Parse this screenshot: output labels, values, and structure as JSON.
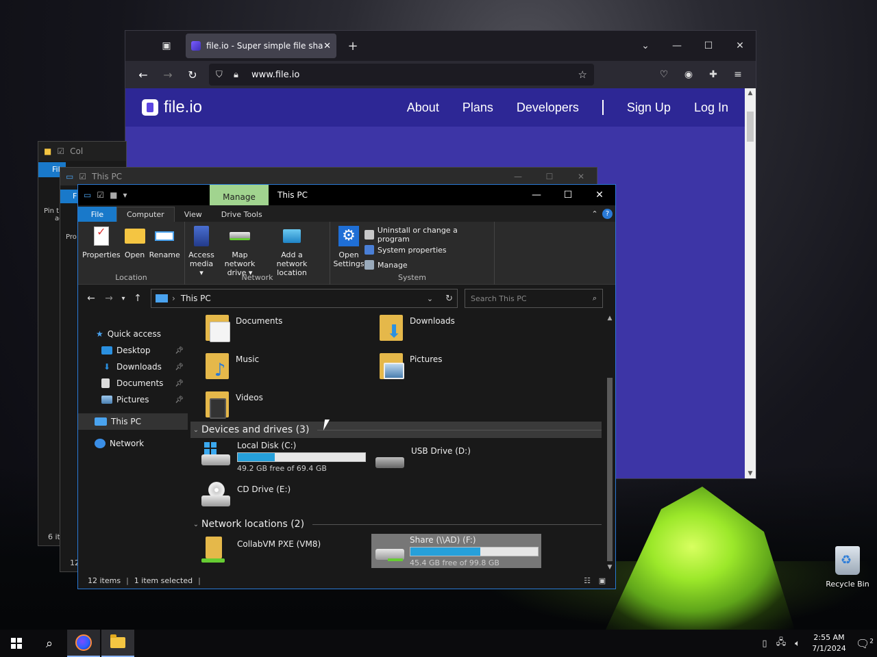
{
  "desktop": {
    "recycle_bin_label": "Recycle Bin"
  },
  "taskbar": {
    "time": "2:55 AM",
    "date": "7/1/2024",
    "notification_count": "2"
  },
  "firefox": {
    "tab_title": "file.io - Super simple file sharing",
    "url": "www.file.io",
    "site": {
      "logo_text": "file.io",
      "nav": [
        "About",
        "Plans",
        "Developers",
        "Sign Up",
        "Log In"
      ]
    }
  },
  "back_window_1": {
    "title": "Col",
    "file_tab": "Fil",
    "pin_text": "Pin t",
    "pin_text2": "ac",
    "status": "6 it"
  },
  "back_window_2": {
    "title": "This PC",
    "status": "12",
    "file_tab": "F",
    "pro_text": "Pro"
  },
  "explorer": {
    "title": "This PC",
    "manage_tab": "Manage",
    "tabs": [
      "File",
      "Computer",
      "View",
      "Drive Tools"
    ],
    "ribbon": {
      "location": {
        "label": "Location",
        "buttons": [
          "Properties",
          "Open",
          "Rename"
        ]
      },
      "network": {
        "label": "Network",
        "buttons": [
          "Access media ▾",
          "Map network drive ▾",
          "Add a network location"
        ]
      },
      "system": {
        "label": "System",
        "open_settings": "Open Settings",
        "items": [
          "Uninstall or change a program",
          "System properties",
          "Manage"
        ]
      }
    },
    "address": "This PC",
    "search_placeholder": "Search This PC",
    "nav_pane": {
      "quick_access": "Quick access",
      "items": [
        "Desktop",
        "Downloads",
        "Documents",
        "Pictures"
      ],
      "this_pc": "This PC",
      "network": "Network"
    },
    "folders": [
      "Documents",
      "Downloads",
      "Music",
      "Pictures",
      "Videos"
    ],
    "devices_header": "Devices and drives (3)",
    "drives": [
      {
        "name": "Local Disk (C:)",
        "free": "49.2 GB free of 69.4 GB",
        "used_fraction": 0.29
      },
      {
        "name": "USB Drive (D:)"
      },
      {
        "name": "CD Drive (E:)"
      }
    ],
    "network_header": "Network locations (2)",
    "network_locations": [
      {
        "name": "CollabVM PXE (VM8)"
      },
      {
        "name": "Share (\\\\AD) (F:)",
        "free": "45.4 GB free of 99.8 GB",
        "used_fraction": 0.55
      }
    ],
    "status": {
      "items": "12 items",
      "selected": "1 item selected"
    }
  },
  "colors": {
    "site_header": "#2d2795",
    "site_body": "#3d35a6",
    "manage_tab": "#a1d48f",
    "file_tab": "#1979ca",
    "drive_bar": "#26a0da"
  }
}
